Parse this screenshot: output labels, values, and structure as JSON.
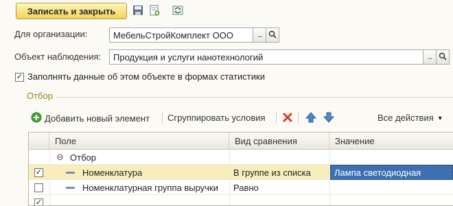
{
  "toolbar": {
    "write_close_label": "Записать и закрыть",
    "icons": [
      "save-icon",
      "save-new-icon",
      "refresh-icon"
    ]
  },
  "organization": {
    "label": "Для организации:",
    "value": "МебельСтройКомплект ООО",
    "pick_glyph": "...",
    "icon": "magnifier-icon"
  },
  "observation": {
    "label": "Объект наблюдения:",
    "value": "Продукция и услуги нанотехнологий",
    "pick_glyph": "...",
    "icon": "magnifier-icon"
  },
  "fill_checkbox": {
    "checked": true,
    "label": "Заполнять данные об этом объекте в формах статистики"
  },
  "filter_group": {
    "title": "Отбор"
  },
  "filter_toolbar": {
    "add_label": "Добавить новый элемент",
    "group_label": "Сгруппировать условия",
    "all_actions_label": "Все действия",
    "icons": [
      "add-icon",
      "delete-icon",
      "move-up-icon",
      "move-down-icon"
    ]
  },
  "grid": {
    "columns": [
      "Поле",
      "Вид сравнения",
      "Значение"
    ],
    "group_row": {
      "collapse_glyph": "⊖",
      "label": "Отбор"
    },
    "rows": [
      {
        "checked": true,
        "field": "Номенклатура",
        "comparison": "В группе из списка",
        "value": "Лампа светодиодная",
        "selected": true
      },
      {
        "checked": false,
        "field": "Номенклатурная группа выручки",
        "comparison": "Равно",
        "value": "",
        "selected": false
      },
      {
        "checked": true,
        "field": "",
        "comparison": "",
        "value": "",
        "selected": false
      }
    ]
  },
  "colors": {
    "primary_button": "#f3d35a",
    "group_title": "#9b7e22",
    "selected_row": "#f8eebb",
    "selected_value": "#3d6fb1",
    "accent_green": "#4aa03a",
    "accent_red": "#d83a2a",
    "accent_blue": "#4f86c6"
  }
}
